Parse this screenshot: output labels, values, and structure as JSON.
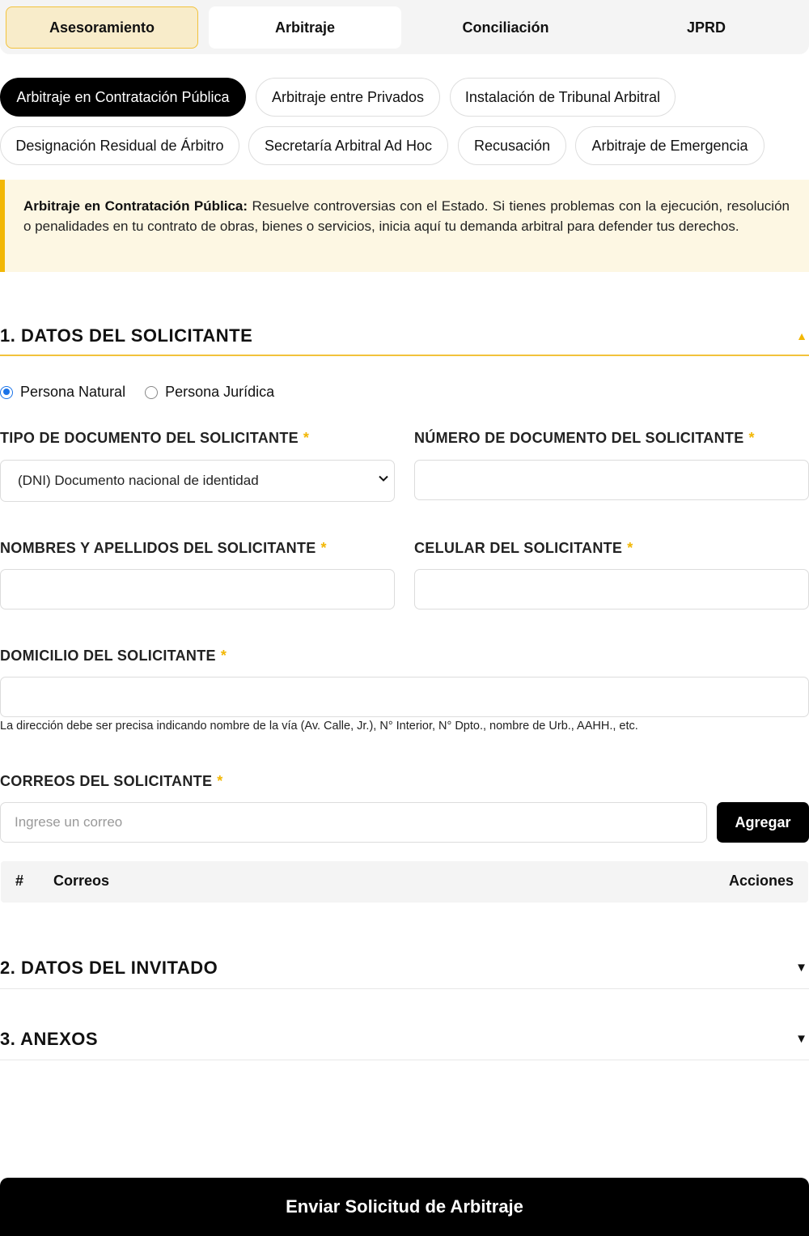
{
  "top_tabs": [
    "Asesoramiento",
    "Arbitraje",
    "Conciliación",
    "JPRD"
  ],
  "service_pills": [
    "Arbitraje en Contratación Pública",
    "Arbitraje entre Privados",
    "Instalación de Tribunal Arbitral",
    "Designación Residual de Árbitro",
    "Secretaría Arbitral Ad Hoc",
    "Recusación",
    "Arbitraje de Emergencia"
  ],
  "info": {
    "title": "Arbitraje en Contratación Pública:",
    "text": " Resuelve controversias con el Estado. Si tienes problemas con la ejecución, resolución o penalidades en tu contrato de obras, bienes o servicios, inicia aquí tu demanda arbitral para defender tus derechos."
  },
  "sections": {
    "s1": "1. DATOS DEL SOLICITANTE",
    "s2": "2. DATOS DEL INVITADO",
    "s3": "3. ANEXOS"
  },
  "person_type": {
    "natural": "Persona Natural",
    "juridica": "Persona Jurídica",
    "selected": "natural"
  },
  "form": {
    "doc_type_label": "TIPO DE DOCUMENTO DEL SOLICITANTE",
    "doc_type_value": "(DNI) Documento nacional de identidad",
    "doc_number_label": "NÚMERO DE DOCUMENTO DEL SOLICITANTE",
    "doc_number_value": "",
    "names_label": "NOMBRES Y APELLIDOS DEL SOLICITANTE",
    "names_value": "",
    "phone_label": "CELULAR DEL SOLICITANTE",
    "phone_value": "",
    "address_label": "DOMICILIO DEL SOLICITANTE",
    "address_value": "",
    "address_hint": "La dirección debe ser precisa indicando nombre de la vía (Av. Calle, Jr.), N° Interior, N° Dpto., nombre de Urb., AAHH., etc.",
    "emails_label": "CORREOS DEL SOLICITANTE",
    "email_placeholder": "Ingrese un correo",
    "add_button": "Agregar",
    "required_mark": "*"
  },
  "emails_table": {
    "columns": [
      "#",
      "Correos",
      "Acciones"
    ],
    "rows": []
  },
  "submit_button": "Enviar Solicitud de Arbitraje",
  "colors": {
    "accent": "#f2c23c",
    "active_pill": "#000000",
    "info_bg": "#fdf7e3",
    "radio_checked": "#1a73e8"
  },
  "icons": {
    "section_open": "caret-up-icon",
    "section_closed": "caret-down-icon",
    "select": "chevron-down-icon"
  }
}
